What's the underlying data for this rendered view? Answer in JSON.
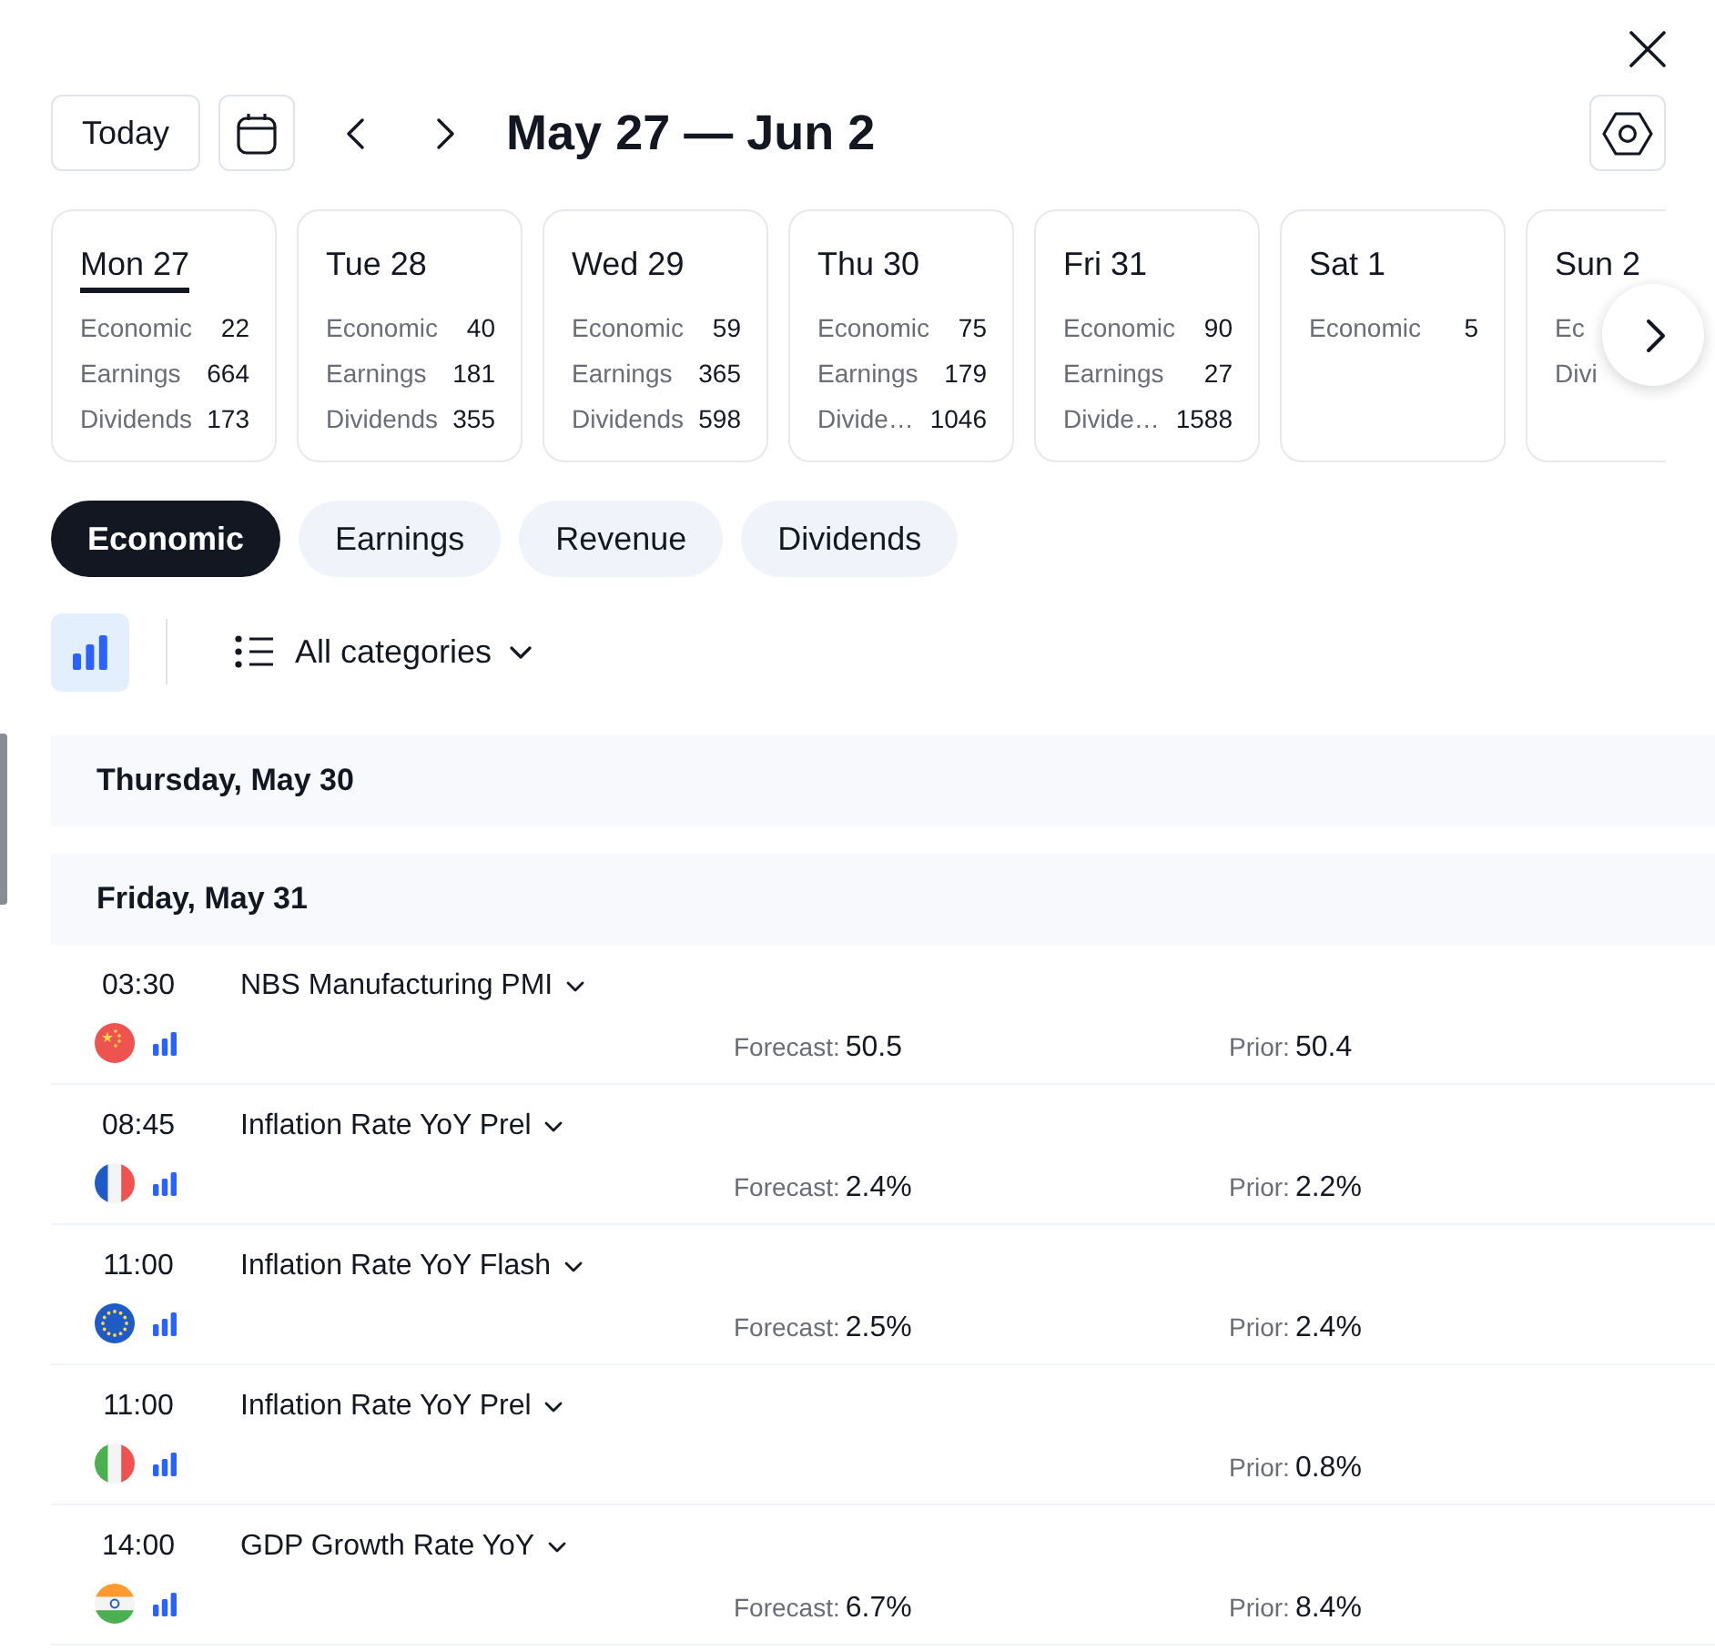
{
  "header": {
    "today": "Today",
    "title": "May 27 — Jun 2"
  },
  "days": [
    {
      "label": "Mon 27",
      "selected": true,
      "counts": [
        {
          "label": "Economic",
          "value": "22"
        },
        {
          "label": "Earnings",
          "value": "664"
        },
        {
          "label": "Dividends",
          "value": "173"
        }
      ]
    },
    {
      "label": "Tue 28",
      "selected": false,
      "counts": [
        {
          "label": "Economic",
          "value": "40"
        },
        {
          "label": "Earnings",
          "value": "181"
        },
        {
          "label": "Dividends",
          "value": "355"
        }
      ]
    },
    {
      "label": "Wed 29",
      "selected": false,
      "counts": [
        {
          "label": "Economic",
          "value": "59"
        },
        {
          "label": "Earnings",
          "value": "365"
        },
        {
          "label": "Dividends",
          "value": "598"
        }
      ]
    },
    {
      "label": "Thu 30",
      "selected": false,
      "counts": [
        {
          "label": "Economic",
          "value": "75"
        },
        {
          "label": "Earnings",
          "value": "179"
        },
        {
          "label": "Divide…",
          "value": "1046"
        }
      ]
    },
    {
      "label": "Fri 31",
      "selected": false,
      "counts": [
        {
          "label": "Economic",
          "value": "90"
        },
        {
          "label": "Earnings",
          "value": "27"
        },
        {
          "label": "Divide…",
          "value": "1588"
        }
      ]
    },
    {
      "label": "Sat 1",
      "selected": false,
      "counts": [
        {
          "label": "Economic",
          "value": "5"
        }
      ]
    },
    {
      "label": "Sun 2",
      "selected": false,
      "counts": [
        {
          "label": "Ec"
        },
        {
          "label": "Divi"
        }
      ]
    }
  ],
  "tabs": [
    {
      "label": "Economic",
      "selected": true
    },
    {
      "label": "Earnings",
      "selected": false
    },
    {
      "label": "Revenue",
      "selected": false
    },
    {
      "label": "Dividends",
      "selected": false
    }
  ],
  "filters": {
    "chart_toggle": {
      "on": true
    },
    "category": "All categories"
  },
  "sections": [
    {
      "title": "Thursday, May 30"
    },
    {
      "title": "Friday, May 31",
      "events": [
        {
          "time": "03:30",
          "name": "NBS Manufacturing PMI",
          "flag": {
            "kind": "china"
          },
          "forecast": {
            "label": "Forecast:",
            "value": "50.5"
          },
          "prior": {
            "label": "Prior:",
            "value": "50.4"
          }
        },
        {
          "time": "08:45",
          "name": "Inflation Rate YoY Prel",
          "flag": {
            "kind": "france"
          },
          "forecast": {
            "label": "Forecast:",
            "value": "2.4%"
          },
          "prior": {
            "label": "Prior:",
            "value": "2.2%"
          }
        },
        {
          "time": "11:00",
          "name": "Inflation Rate YoY Flash",
          "flag": {
            "kind": "eu"
          },
          "forecast": {
            "label": "Forecast:",
            "value": "2.5%"
          },
          "prior": {
            "label": "Prior:",
            "value": "2.4%"
          }
        },
        {
          "time": "11:00",
          "name": "Inflation Rate YoY Prel",
          "flag": {
            "kind": "italy"
          },
          "prior": {
            "label": "Prior:",
            "value": "0.8%"
          }
        },
        {
          "time": "14:00",
          "name": "GDP Growth Rate YoY",
          "flag": {
            "kind": "india"
          },
          "forecast": {
            "label": "Forecast:",
            "value": "6.7%"
          },
          "prior": {
            "label": "Prior:",
            "value": "8.4%"
          }
        }
      ]
    }
  ]
}
